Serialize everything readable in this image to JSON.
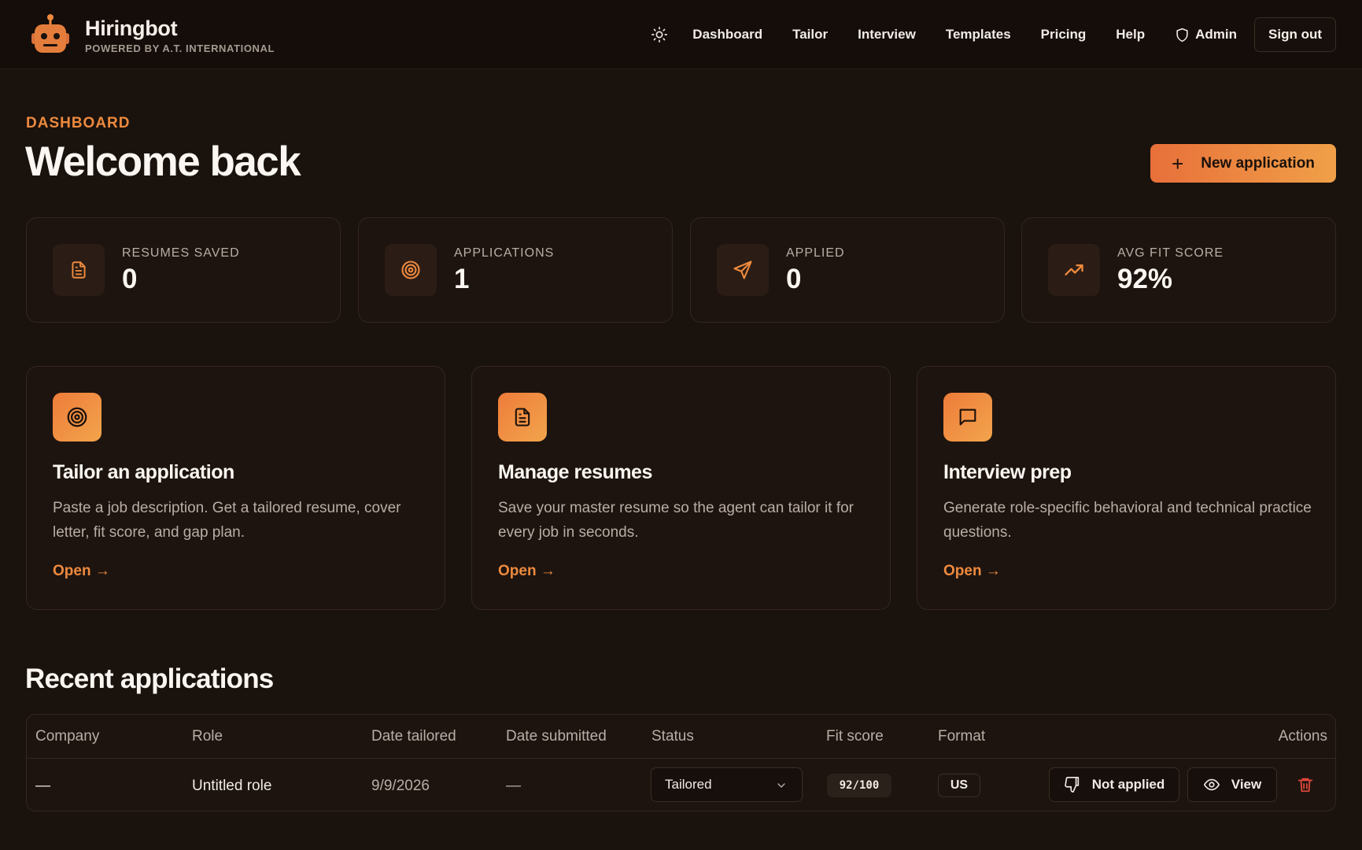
{
  "brand": {
    "name": "Hiringbot",
    "tagline": "POWERED BY A.T. INTERNATIONAL",
    "icon": "robot-icon"
  },
  "nav": {
    "theme_icon": "sun-icon",
    "links": [
      "Dashboard",
      "Tailor",
      "Interview",
      "Templates",
      "Pricing",
      "Help"
    ],
    "admin": "Admin",
    "admin_icon": "shield-icon",
    "signout": "Sign out"
  },
  "header": {
    "eyebrow": "DASHBOARD",
    "title": "Welcome back",
    "new_button": "New application"
  },
  "stats": [
    {
      "label": "RESUMES SAVED",
      "value": "0",
      "icon": "document-icon"
    },
    {
      "label": "APPLICATIONS",
      "value": "1",
      "icon": "target-icon"
    },
    {
      "label": "APPLIED",
      "value": "0",
      "icon": "send-icon"
    },
    {
      "label": "AVG FIT SCORE",
      "value": "92%",
      "icon": "trending-up-icon"
    }
  ],
  "cards": [
    {
      "title": "Tailor an application",
      "desc": "Paste a job description. Get a tailored resume, cover letter, fit score, and gap plan.",
      "link": "Open →",
      "icon": "target-icon"
    },
    {
      "title": "Manage resumes",
      "desc": "Save your master resume so the agent can tailor it for every job in seconds.",
      "link": "Open →",
      "icon": "document-icon"
    },
    {
      "title": "Interview prep",
      "desc": "Generate role-specific behavioral and technical practice questions.",
      "link": "Open →",
      "icon": "chat-icon"
    }
  ],
  "recent": {
    "title": "Recent applications",
    "columns": [
      "Company",
      "Role",
      "Date tailored",
      "Date submitted",
      "Status",
      "Fit score",
      "Format",
      "Actions"
    ],
    "rows": [
      {
        "company": "—",
        "role": "Untitled role",
        "date_tailored": "9/9/2026",
        "date_submitted": "—",
        "status": "Tailored",
        "fit": "92/100",
        "format": "US",
        "not_applied": "Not applied",
        "view": "View"
      }
    ]
  },
  "colors": {
    "accent": "#ee8a3e",
    "bg": "#1a120d",
    "card": "#1d140f"
  }
}
